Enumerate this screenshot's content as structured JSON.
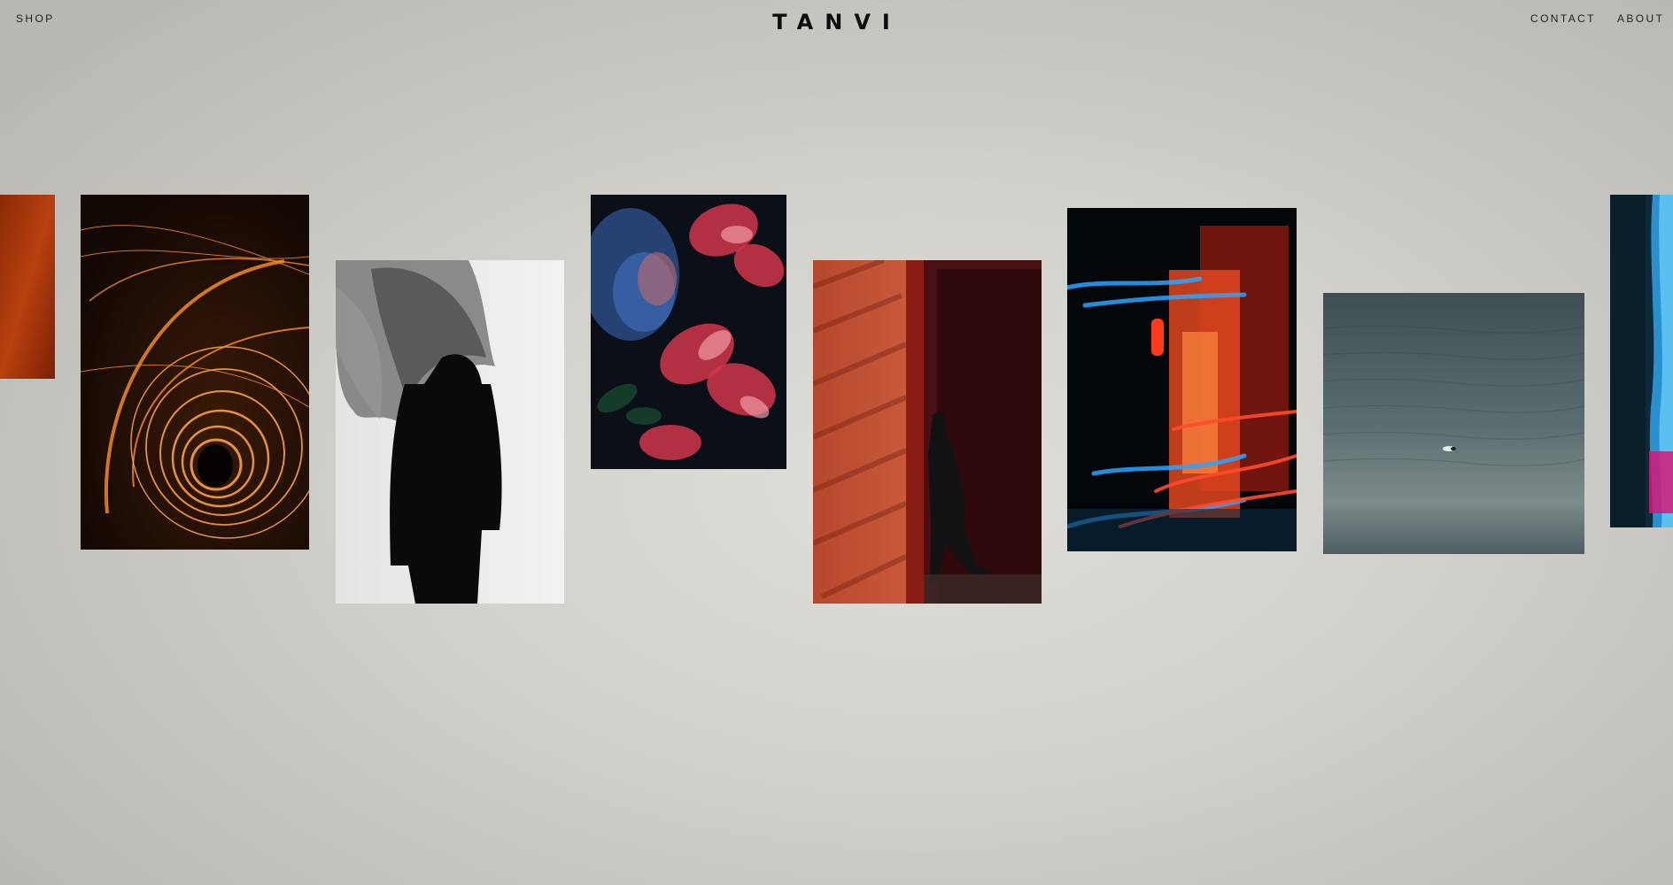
{
  "header": {
    "brand": "TANVI",
    "nav_left": "SHOP",
    "nav_right": [
      "CONTACT",
      "ABOUT"
    ]
  },
  "colors": {
    "background": "#d6d4cf",
    "text": "#1a1a1a"
  },
  "gallery": {
    "photos": [
      {
        "name": "photo-orange-edge",
        "subject": "orange gradient abstract (partially visible)"
      },
      {
        "name": "photo-steel-wool-spiral",
        "subject": "orange light-painting spiral"
      },
      {
        "name": "photo-silhouette-fabric",
        "subject": "black silhouette with flowing sheer fabric"
      },
      {
        "name": "photo-face-flowers",
        "subject": "face double-exposed with flowers in red and blue light"
      },
      {
        "name": "photo-red-doorway",
        "subject": "person walking through red doorway with shadows"
      },
      {
        "name": "photo-neon-street",
        "subject": "blurred neon street with red lantern"
      },
      {
        "name": "photo-sea-boat",
        "subject": "small boat on dark teal sea"
      },
      {
        "name": "photo-blue-streak",
        "subject": "blue light streak (partially visible)"
      }
    ]
  }
}
